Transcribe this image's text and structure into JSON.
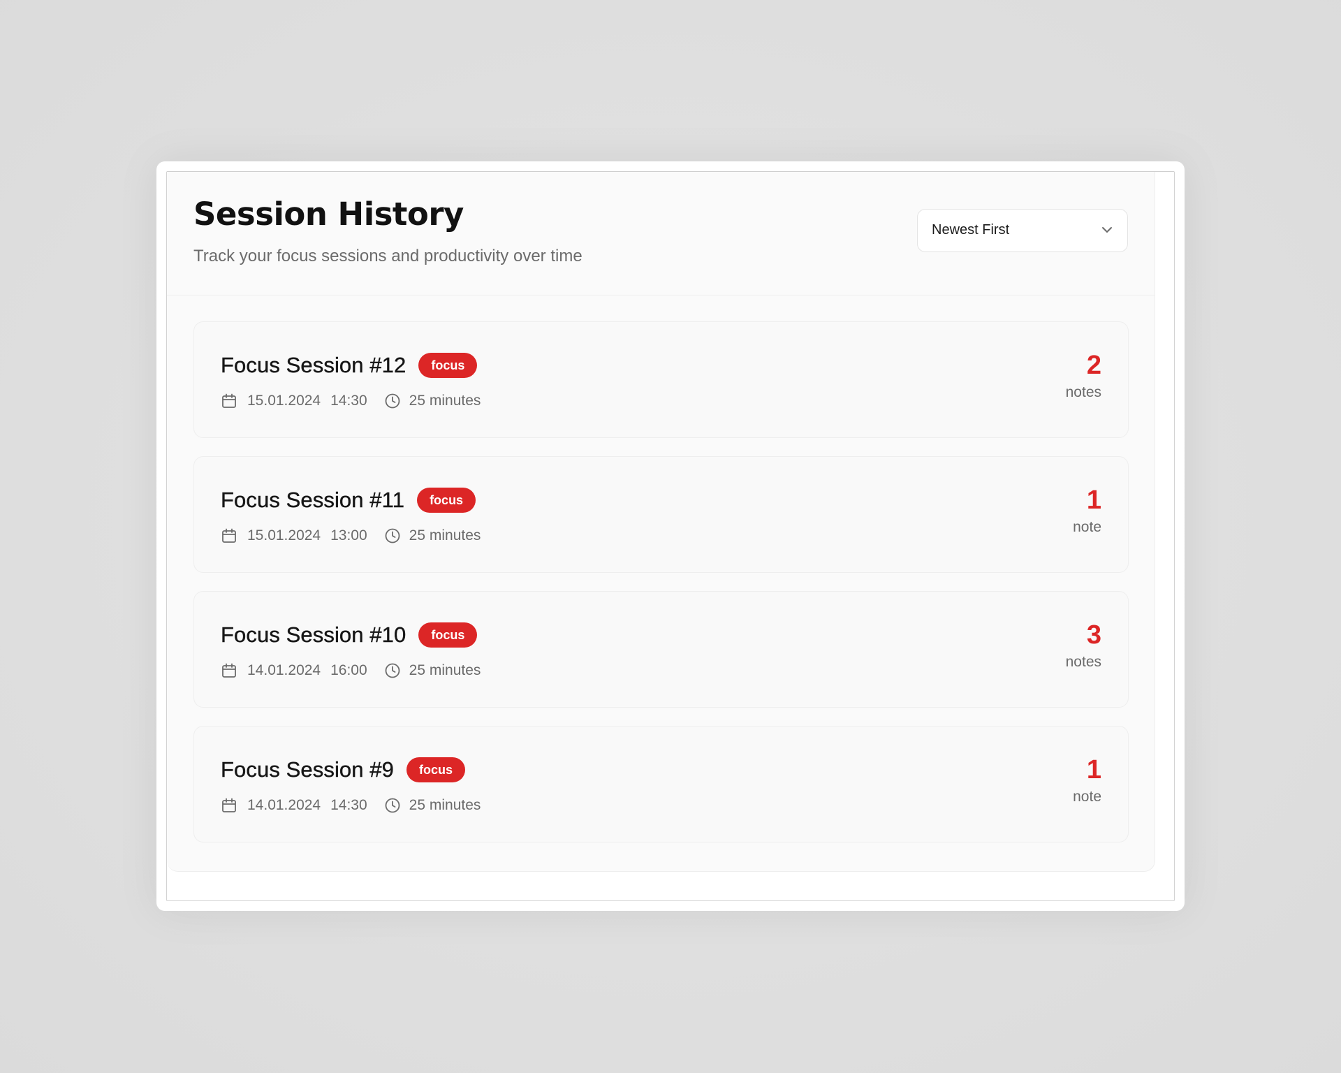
{
  "header": {
    "title": "Session History",
    "subtitle": "Track your focus sessions and productivity over time"
  },
  "sort": {
    "selected": "Newest First",
    "icon": "chevron-down-icon"
  },
  "colors": {
    "accent": "#dc2626",
    "muted_text": "#6b6b6b",
    "card_bg": "#f9f9f9"
  },
  "sessions": [
    {
      "title": "Focus Session #12",
      "tag": "focus",
      "date": "15.01.2024",
      "time": "14:30",
      "duration": "25 minutes",
      "notes_count": "2",
      "notes_label": "notes"
    },
    {
      "title": "Focus Session #11",
      "tag": "focus",
      "date": "15.01.2024",
      "time": "13:00",
      "duration": "25 minutes",
      "notes_count": "1",
      "notes_label": "note"
    },
    {
      "title": "Focus Session #10",
      "tag": "focus",
      "date": "14.01.2024",
      "time": "16:00",
      "duration": "25 minutes",
      "notes_count": "3",
      "notes_label": "notes"
    },
    {
      "title": "Focus Session #9",
      "tag": "focus",
      "date": "14.01.2024",
      "time": "14:30",
      "duration": "25 minutes",
      "notes_count": "1",
      "notes_label": "note"
    }
  ]
}
